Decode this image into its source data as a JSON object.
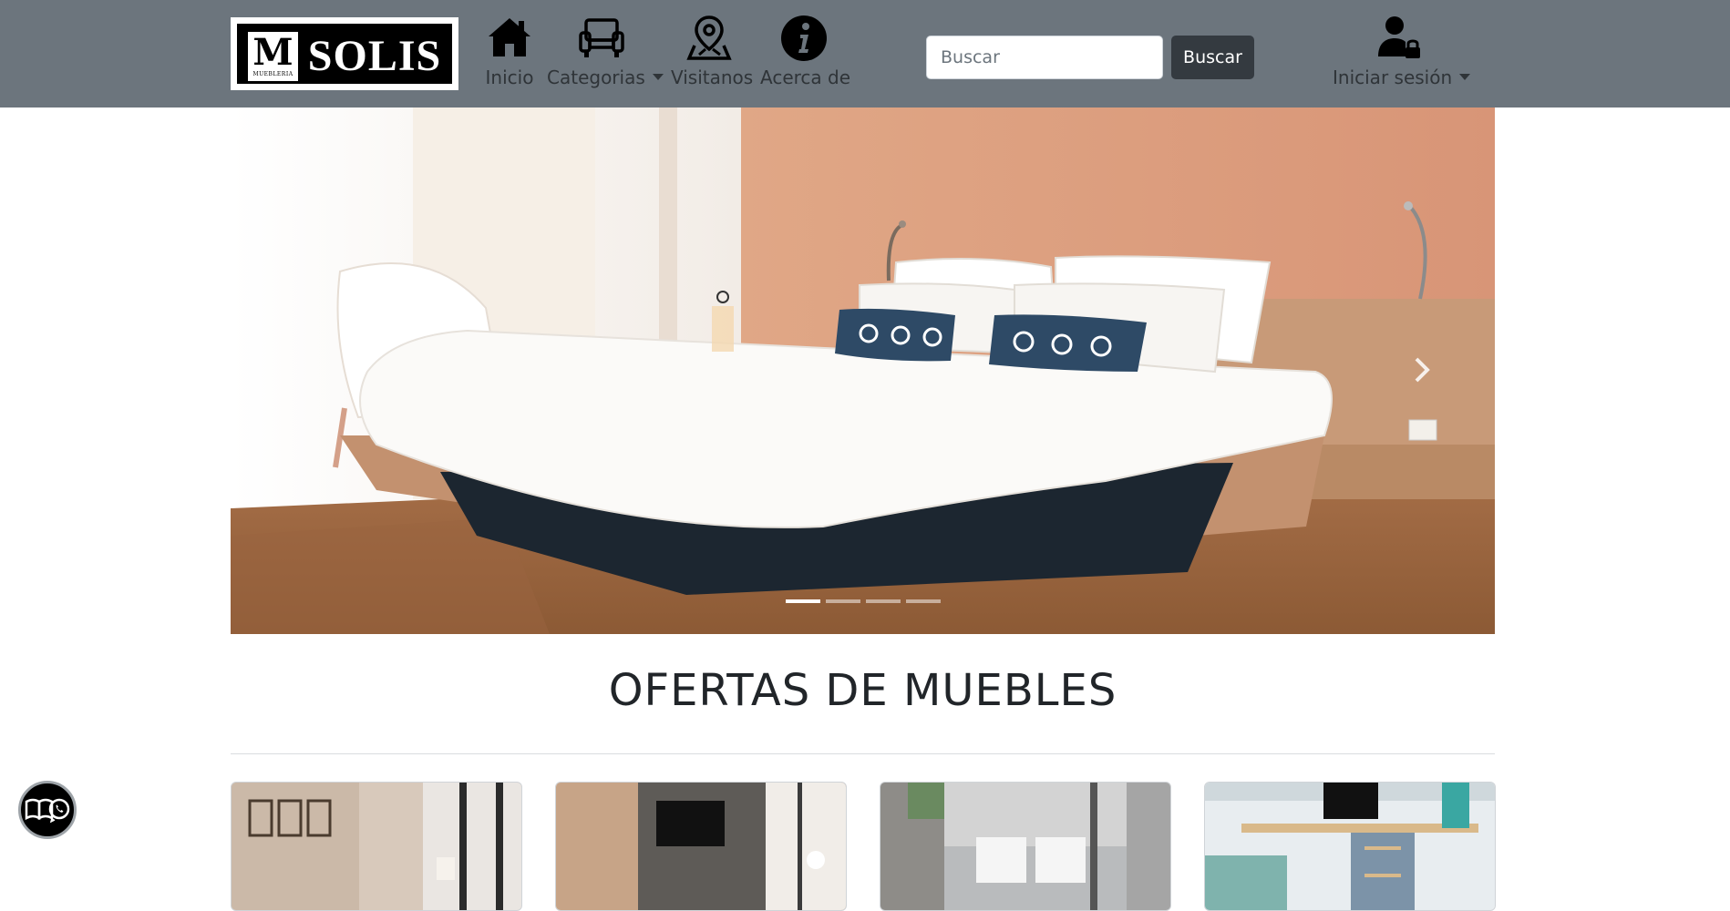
{
  "logo": {
    "letter": "M",
    "subtext": "MUEBLERIA",
    "name": "SOLIS"
  },
  "nav": {
    "inicio": "Inicio",
    "categorias": "Categorias",
    "visitanos": "Visitanos",
    "acerca": "Acerca de",
    "login": "Iniciar sesión"
  },
  "search": {
    "placeholder": "Buscar",
    "button_label": "Buscar"
  },
  "carousel": {
    "slide_count": 4,
    "active_index": 0
  },
  "section": {
    "title": "OFERTAS DE MUEBLES"
  },
  "cards": [
    {
      "icon": "living-room-photo"
    },
    {
      "icon": "tv-room-photo"
    },
    {
      "icon": "bedroom-photo"
    },
    {
      "icon": "desk-photo"
    }
  ],
  "float_button": {
    "icons": [
      "book-icon",
      "whatsapp-icon"
    ]
  },
  "colors": {
    "navbar": "#6c757d",
    "search_button": "#343a40",
    "nav_text": "#2f3438"
  }
}
